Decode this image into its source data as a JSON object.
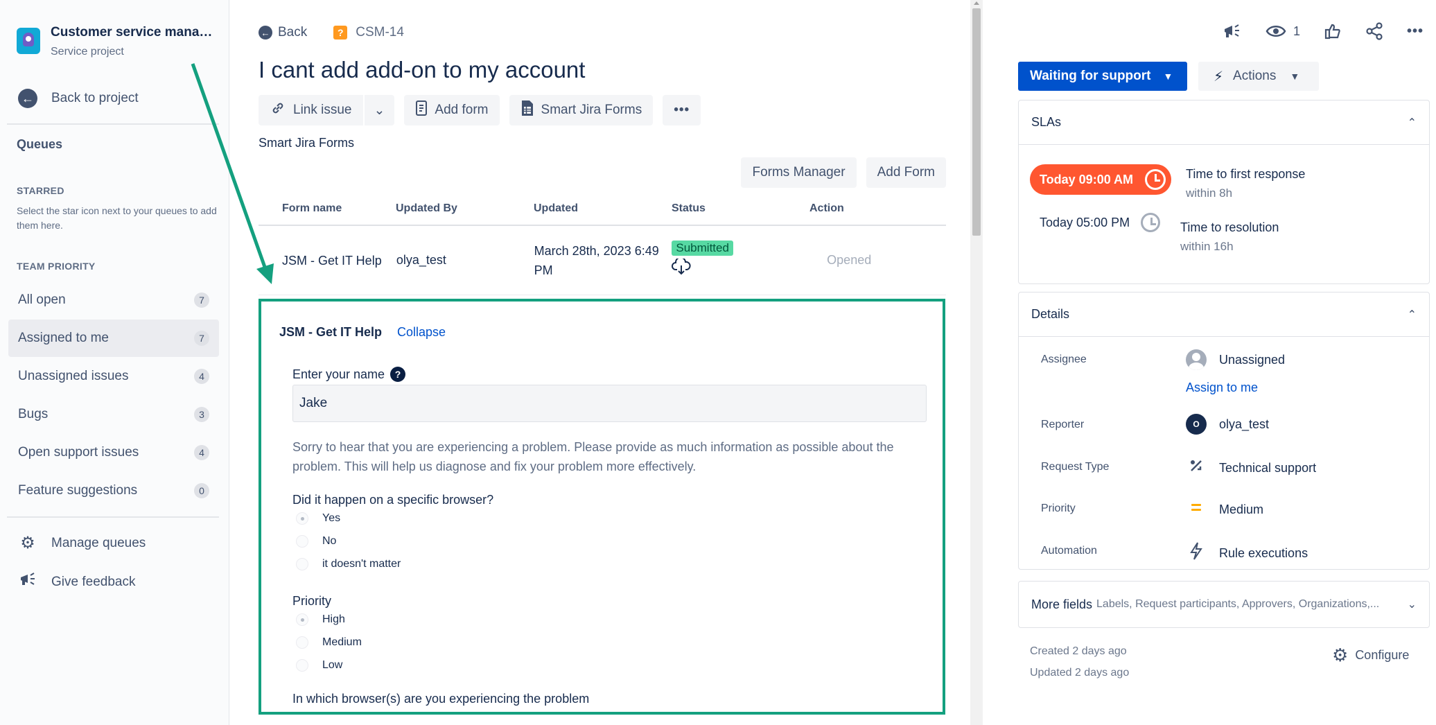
{
  "sidebar": {
    "project_title": "Customer service manag...",
    "project_subtitle": "Service project",
    "back_to_project": "Back to project",
    "queues_heading": "Queues",
    "starred_heading": "STARRED",
    "starred_note": "Select the star icon next to your queues to add them here.",
    "team_priority_heading": "TEAM PRIORITY",
    "queues": [
      {
        "label": "All open",
        "count": "7"
      },
      {
        "label": "Assigned to me",
        "count": "7"
      },
      {
        "label": "Unassigned issues",
        "count": "4"
      },
      {
        "label": "Bugs",
        "count": "3"
      },
      {
        "label": "Open support issues",
        "count": "4"
      },
      {
        "label": "Feature suggestions",
        "count": "0"
      }
    ],
    "manage_queues": "Manage queues",
    "give_feedback": "Give feedback"
  },
  "issue": {
    "back_label": "Back",
    "key": "CSM-14",
    "title": "I cant add add-on to my account",
    "toolbar": {
      "link_issue": "Link issue",
      "add_form": "Add form",
      "smart_jira_forms": "Smart Jira Forms",
      "more": "•••"
    }
  },
  "forms": {
    "section_title": "Smart Jira Forms",
    "forms_manager": "Forms Manager",
    "add_form": "Add Form",
    "columns": [
      "Form name",
      "Updated By",
      "Updated",
      "Status",
      "Action"
    ],
    "row": {
      "form_name": "JSM - Get IT Help",
      "updated_by": "olya_test",
      "updated": "March 28th, 2023 6:49 PM",
      "status": "Submitted",
      "action": "Opened"
    },
    "panel": {
      "title": "JSM - Get IT Help",
      "collapse": "Collapse",
      "name_label": "Enter your name",
      "name_value": "Jake",
      "description": "Sorry to hear that you are experiencing a problem. Please provide as much information as possible about the problem. This will help us diagnose and fix your problem more effectively.",
      "browser_question": "Did it happen on a specific browser?",
      "browser_options": [
        "Yes",
        "No",
        "it doesn't matter"
      ],
      "priority_label": "Priority",
      "priority_options": [
        "High",
        "Medium",
        "Low"
      ],
      "which_browser": "In which browser(s) are you experiencing the problem"
    }
  },
  "right": {
    "watch_count": "1",
    "status": "Waiting for support",
    "actions": "Actions",
    "slas_heading": "SLAs",
    "sla1": {
      "time": "Today 09:00 AM",
      "label": "Time to first response",
      "within": "within 8h"
    },
    "sla2": {
      "time": "Today 05:00 PM",
      "label": "Time to resolution",
      "within": "within 16h"
    },
    "details_heading": "Details",
    "details": {
      "assignee_label": "Assignee",
      "assignee_value": "Unassigned",
      "assign_to_me": "Assign to me",
      "reporter_label": "Reporter",
      "reporter_initial": "O",
      "reporter_value": "olya_test",
      "request_type_label": "Request Type",
      "request_type_value": "Technical support",
      "priority_label": "Priority",
      "priority_value": "Medium",
      "automation_label": "Automation",
      "automation_value": "Rule executions"
    },
    "more_fields": "More fields",
    "more_fields_sub": "Labels, Request participants, Approvers, Organizations,...",
    "created": "Created 2 days ago",
    "updated": "Updated 2 days ago",
    "configure": "Configure"
  },
  "colors": {
    "primary": "#0052cc",
    "annotation_green": "#14a07f",
    "sla_breach": "#ff5630",
    "submitted": "#57d9a3"
  }
}
